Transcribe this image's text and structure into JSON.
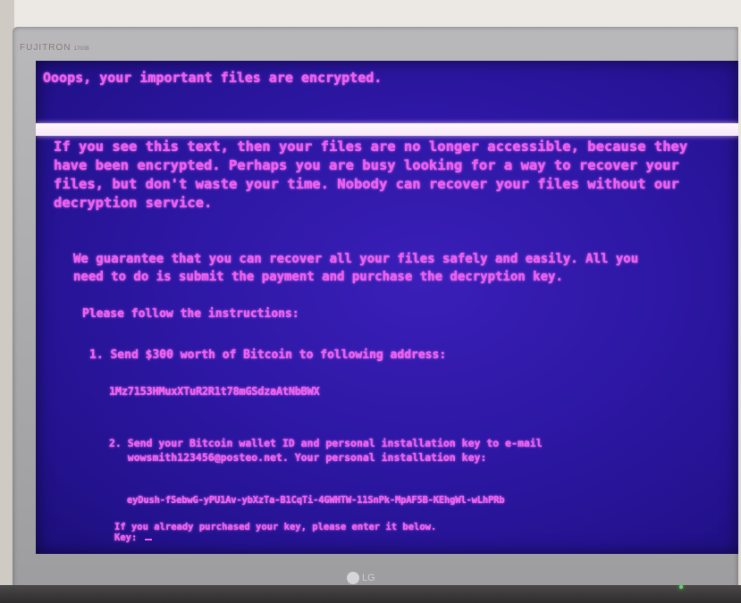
{
  "monitor": {
    "brand": "FUJITRON",
    "model": "1700B",
    "logo": "LG"
  },
  "screen": {
    "title": "Ooops, your important files are encrypted.",
    "intro_lines": [
      "If you see this text, then your files are no longer accessible, because they",
      "have been encrypted.  Perhaps you are busy looking for a way to recover your",
      "files, but don't waste your time.  Nobody can recover your files without our",
      "decryption service."
    ],
    "guarantee_lines": [
      "We guarantee that you can recover all your files safely and easily.  All you",
      "need to do is submit the payment and purchase the decryption key."
    ],
    "instructions_heading": "Please follow the instructions:",
    "step1": "1. Send $300 worth of Bitcoin to following address:",
    "bitcoin_address": "1Mz7153HMuxXTuR2R1t78mGSdzaAtNbBWX",
    "step2_lines": [
      "2. Send your Bitcoin wallet ID and personal installation key to e-mail",
      "   wowsmith123456@posteo.net. Your personal installation key:"
    ],
    "installation_key": "eyDush-fSebwG-yPU1Av-ybXzTa-B1CqTi-4GWHTW-11SnPk-MpAF5B-KEhgWl-wLhPRb",
    "key_prompt_lines": [
      "If you already purchased your key, please enter it below.",
      "Key: "
    ]
  },
  "colors": {
    "screen_bg": "#2d17a4",
    "text": "#f25cf0",
    "bar": "#fff6fb"
  }
}
